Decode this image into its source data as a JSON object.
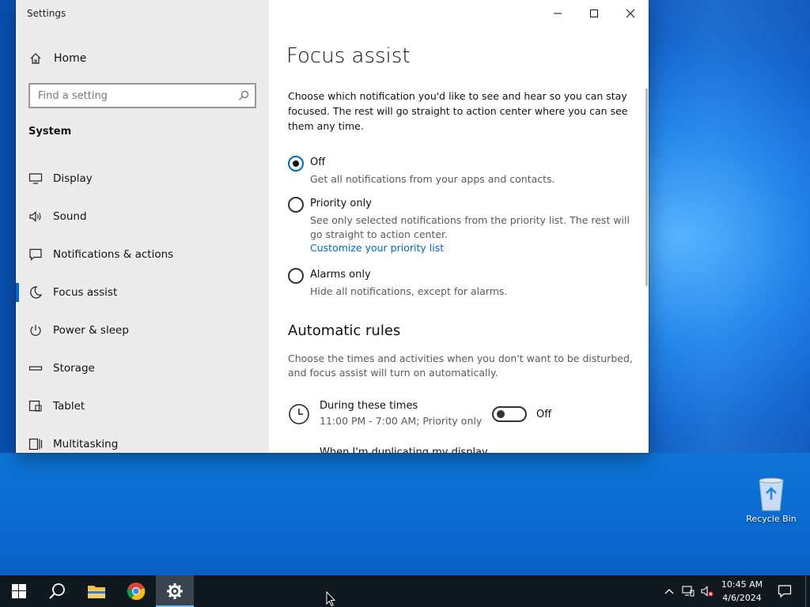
{
  "window": {
    "title": "Settings",
    "controls": {
      "minimize": "minimize",
      "maximize": "maximize",
      "close": "close"
    }
  },
  "sidebar": {
    "home_label": "Home",
    "search_placeholder": "Find a setting",
    "section_title": "System",
    "items": [
      {
        "label": "Display",
        "icon": "display-icon"
      },
      {
        "label": "Sound",
        "icon": "sound-icon"
      },
      {
        "label": "Notifications & actions",
        "icon": "notifications-icon"
      },
      {
        "label": "Focus assist",
        "icon": "moon-icon",
        "active": true
      },
      {
        "label": "Power & sleep",
        "icon": "power-icon"
      },
      {
        "label": "Storage",
        "icon": "storage-icon"
      },
      {
        "label": "Tablet",
        "icon": "tablet-icon"
      },
      {
        "label": "Multitasking",
        "icon": "multitasking-icon"
      }
    ]
  },
  "main": {
    "title": "Focus assist",
    "intro": "Choose which notification you'd like to see and hear so you can stay focused. The rest will go straight to action center where you can see them any time.",
    "options": [
      {
        "title": "Off",
        "desc": "Get all notifications from your apps and contacts.",
        "checked": true
      },
      {
        "title": "Priority only",
        "desc": "See only selected notifications from the priority list. The rest will go straight to action center.",
        "link": "Customize your priority list",
        "checked": false
      },
      {
        "title": "Alarms only",
        "desc": "Hide all notifications, except for alarms.",
        "checked": false
      }
    ],
    "rules_title": "Automatic rules",
    "rules_desc": "Choose the times and activities when you don't want to be disturbed, and focus assist will turn on automatically.",
    "rule": {
      "name": "During these times",
      "time": "11:00 PM - 7:00 AM; Priority only",
      "toggle_state": "Off"
    },
    "cut_rule": "When I'm duplicating my display"
  },
  "desktop": {
    "recycle_bin": "Recycle Bin"
  },
  "taskbar": {
    "time": "10:45 AM",
    "date": "4/6/2024"
  },
  "colors": {
    "accent": "#0067c0",
    "taskbar": "#101820"
  }
}
